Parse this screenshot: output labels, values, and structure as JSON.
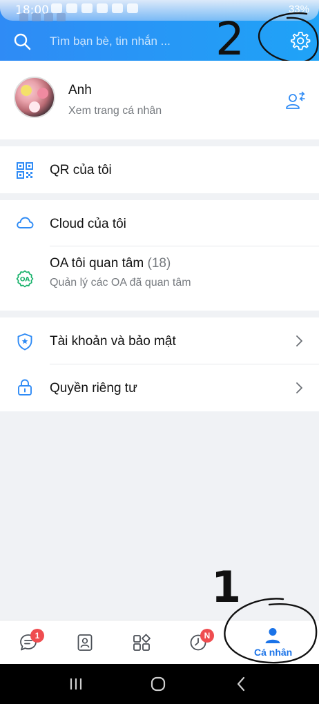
{
  "status_bar": {
    "time": "18:00",
    "battery": "33%"
  },
  "search": {
    "placeholder": "Tìm bạn bè, tin nhắn ..."
  },
  "profile": {
    "name": "Anh",
    "subtitle": "Xem trang cá nhân"
  },
  "menu": {
    "qr": {
      "label": "QR của tôi"
    },
    "cloud": {
      "label": "Cloud của tôi"
    },
    "oa": {
      "label": "OA tôi quan tâm",
      "count": "(18)",
      "subtitle": "Quản lý các OA đã quan tâm"
    },
    "account": {
      "label": "Tài khoản và bảo mật"
    },
    "privacy": {
      "label": "Quyền riêng tư"
    }
  },
  "bottom_nav": {
    "messages": {
      "badge": "1"
    },
    "timeline": {
      "badge": "N"
    },
    "me": {
      "label": "Cá nhân"
    }
  },
  "annotations": {
    "step_1": "1",
    "step_2": "2"
  },
  "colors": {
    "accent": "#1a73e8",
    "header": "#2196f3",
    "badge": "#ef4d50"
  }
}
